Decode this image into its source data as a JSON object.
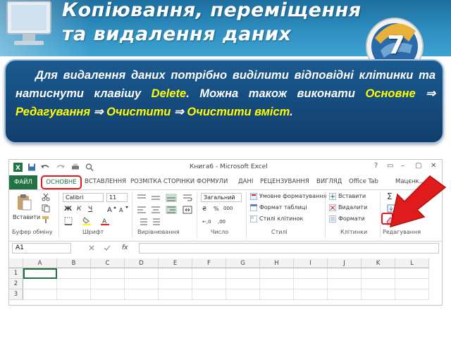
{
  "slide": {
    "title_line1": "Копіювання, переміщення",
    "title_line2": "та видалення даних",
    "badge_number": "7",
    "info": {
      "part1": "Для видалення даних потрібно виділити відповідні клітинки та натиснути клавішу ",
      "key": "Delete",
      "part2": ". Можна також виконати ",
      "path1": "Основне",
      "arrow": "⇒",
      "path2": "Редагування",
      "path3": "Очистити",
      "path4": "Очистити вміст",
      "end": "."
    }
  },
  "excel": {
    "window_title": "Книга6 - Microsoft Excel",
    "window_buttons": [
      "?",
      "▭",
      "–",
      "▢",
      "✕"
    ],
    "tabs": {
      "file": "ФАЙЛ",
      "home": "ОСНОВНЕ",
      "insert": "ВСТАВЛЕННЯ",
      "page_layout": "РОЗМІТКА СТОРІНКИ",
      "formulas": "ФОРМУЛИ",
      "data": "ДАНІ",
      "review": "РЕЦЕНЗУВАННЯ",
      "view": "ВИГЛЯД",
      "office_tab": "Office Tab",
      "user": "Мацєнк..."
    },
    "ribbon": {
      "paste": "Вставити",
      "font_name": "Calibri",
      "font_size": "11",
      "bold": "Ж",
      "italic": "К",
      "underline": "Ч",
      "number_format": "Загальний",
      "conditional_formatting": "Умовне форматування",
      "format_as_table": "Формат таблиці",
      "cell_styles": "Стилі клітинок",
      "insert_cells": "Вставити",
      "delete_cells": "Видалити",
      "format_cells": "Формати",
      "groups": {
        "clipboard": "Буфер обміну",
        "font": "Шрифт",
        "alignment": "Вирівнювання",
        "number": "Число",
        "styles": "Стилі",
        "cells": "Клітинки",
        "editing": "Редагування"
      },
      "currency_symbol": "₴",
      "percent_symbol": "%",
      "comma_symbol": "000",
      "sigma_symbol": "Σ"
    },
    "formula_bar": {
      "name_box": "A1",
      "fx": "fx",
      "content": ""
    },
    "columns": [
      "A",
      "B",
      "C",
      "D",
      "E",
      "F",
      "G",
      "H",
      "I",
      "J",
      "K",
      "L"
    ],
    "rows": [
      "1",
      "2",
      "3"
    ],
    "accent_green": "#217346",
    "highlight_red": "#e01b1b"
  }
}
